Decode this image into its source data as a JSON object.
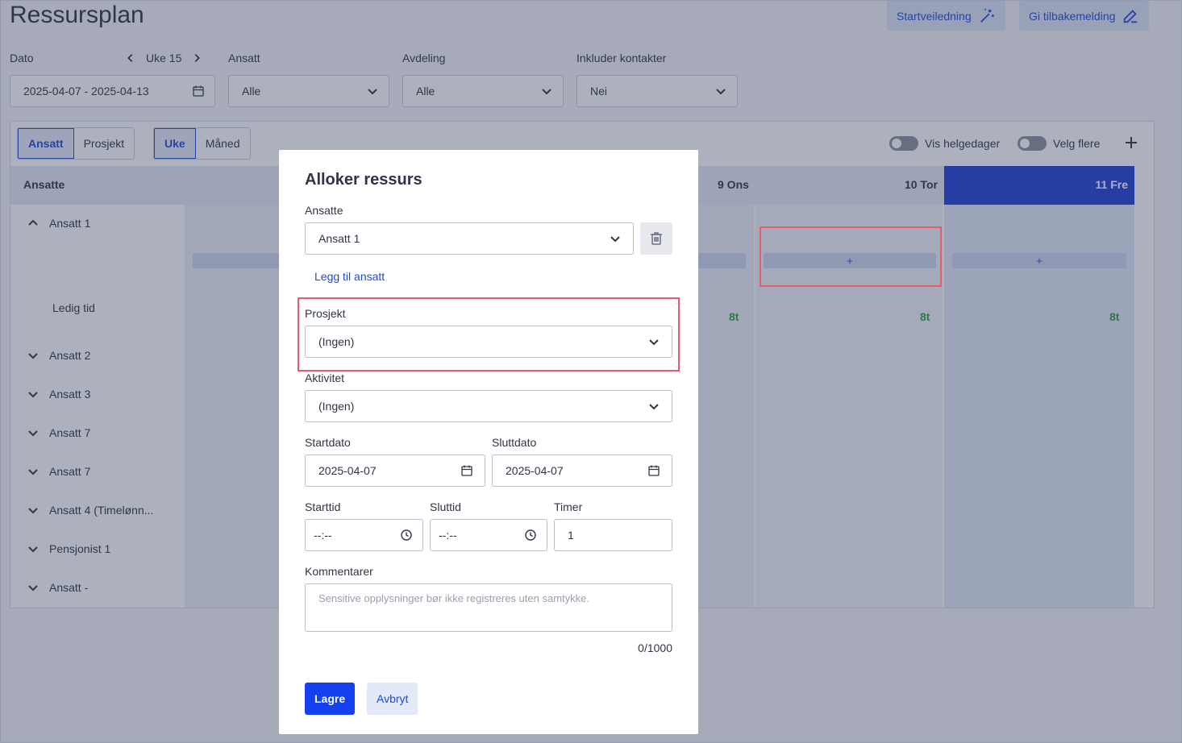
{
  "page": {
    "title": "Ressursplan",
    "guide_button": "Startveiledning",
    "feedback_button": "Gi tilbakemelding"
  },
  "filters": {
    "date_label": "Dato",
    "week_label": "Uke 15",
    "date_value": "2025-04-07 - 2025-04-13",
    "employee_label": "Ansatt",
    "employee_value": "Alle",
    "department_label": "Avdeling",
    "department_value": "Alle",
    "contacts_label": "Inkluder kontakter",
    "contacts_value": "Nei"
  },
  "toolbar": {
    "view_tabs": [
      "Ansatt",
      "Prosjekt"
    ],
    "period_tabs": [
      "Uke",
      "Måned"
    ],
    "show_weekend_label": "Vis helgedager",
    "select_multiple_label": "Velg flere"
  },
  "grid": {
    "header_label": "Ansatte",
    "days": [
      "9 Ons",
      "10 Tor",
      "11 Fre"
    ],
    "add_symbol": "+",
    "hours": [
      "8t",
      "8t",
      "8t"
    ],
    "free_time_label": "Ledig tid",
    "rows": [
      "Ansatt 1",
      "Ansatt 2",
      "Ansatt 3",
      "Ansatt 7",
      "Ansatt 7",
      "Ansatt 4 (Timelønn...",
      "Pensjonist 1",
      "Ansatt -"
    ]
  },
  "modal": {
    "title": "Alloker ressurs",
    "employees_label": "Ansatte",
    "employee_value": "Ansatt 1",
    "add_employee_link": "Legg til ansatt",
    "project_label": "Prosjekt",
    "project_value": "(Ingen)",
    "activity_label": "Aktivitet",
    "activity_value": "(Ingen)",
    "start_date_label": "Startdato",
    "start_date_value": "2025-04-07",
    "end_date_label": "Sluttdato",
    "end_date_value": "2025-04-07",
    "start_time_label": "Starttid",
    "start_time_value": "--:--",
    "end_time_label": "Sluttid",
    "end_time_value": "--:--",
    "hours_label": "Timer",
    "hours_value": "1",
    "comments_label": "Kommentarer",
    "comments_placeholder": "Sensitive opplysninger bør ikke registreres uten samtykke.",
    "char_counter": "0/1000",
    "save_button": "Lagre",
    "cancel_button": "Avbryt"
  },
  "colors": {
    "accent": "#1e4ad6",
    "primary_button": "#1440f0",
    "highlight": "#e35d6a",
    "hours_green": "#2ba33e"
  }
}
